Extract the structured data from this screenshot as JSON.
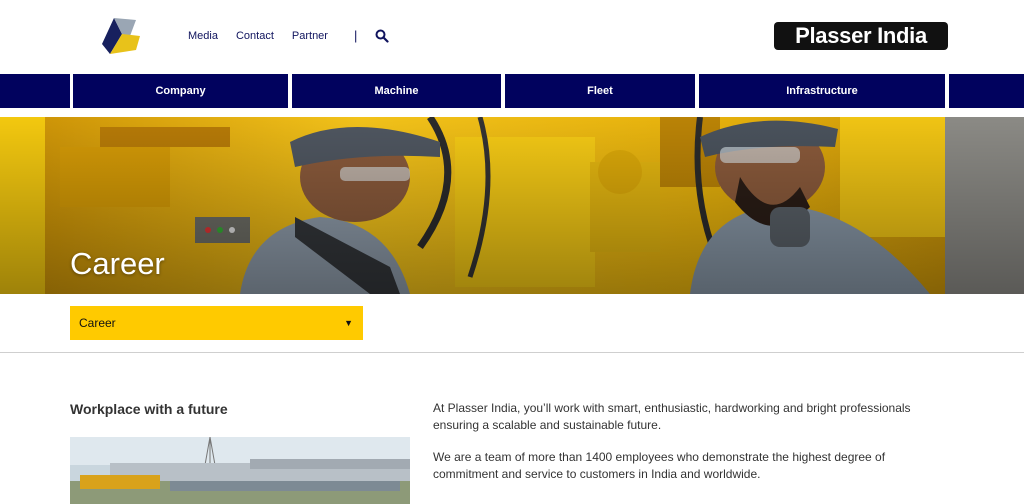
{
  "header": {
    "links": [
      "Media",
      "Contact",
      "Partner"
    ],
    "separator": "|",
    "search_icon": "search-icon",
    "brand": "Plasser India"
  },
  "nav": {
    "items": [
      "Company",
      "Machine",
      "Fleet",
      "Infrastructure"
    ],
    "color": "#01025e"
  },
  "hero": {
    "title": "Career"
  },
  "dropdown": {
    "selected": "Career",
    "color": "#ffca00"
  },
  "content": {
    "section_title": "Workplace with a future",
    "paragraphs": [
      "At Plasser India, you’ll work with smart, enthusiastic, hardworking  and bright professionals ensuring a scalable and sustainable future.",
      "We are a team of more than 1400 employees who demonstrate the highest degree of commitment and service to customers in India and worldwide."
    ]
  }
}
